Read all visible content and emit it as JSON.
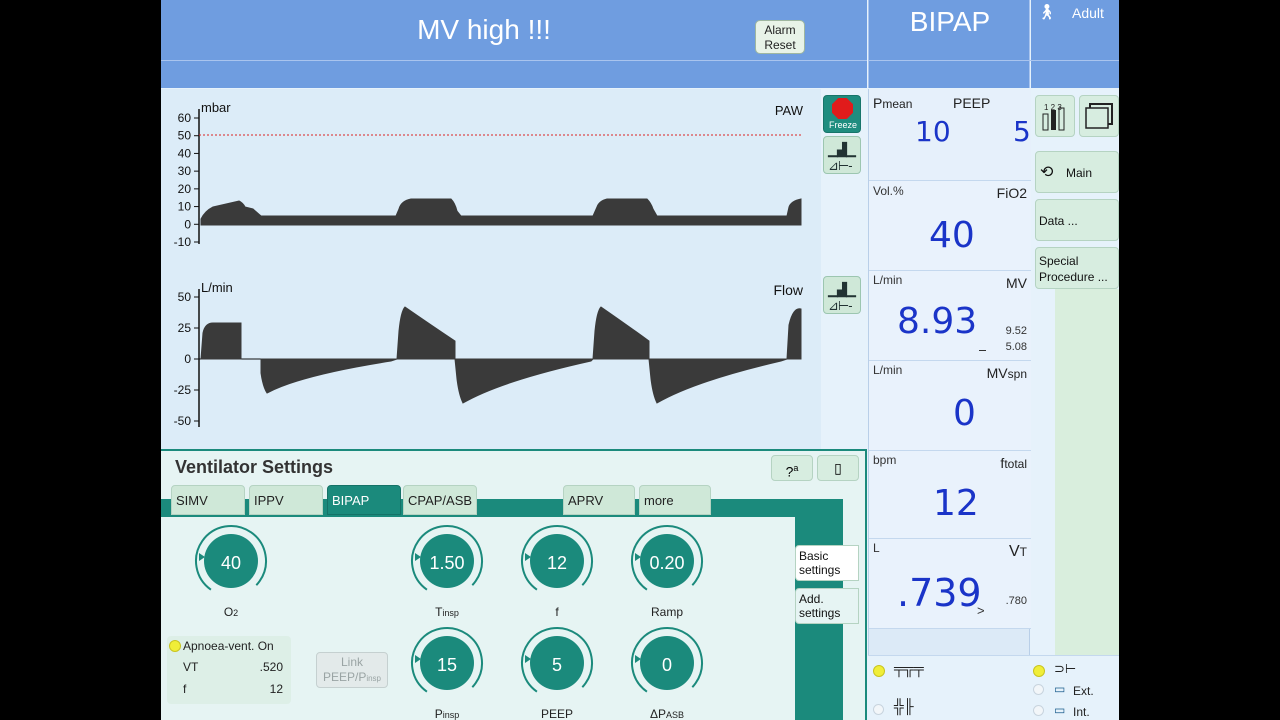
{
  "header": {
    "alarm_message": "MV high !!!",
    "alarm_reset_line1": "Alarm",
    "alarm_reset_line2": "Reset",
    "mode": "BIPAP",
    "patient_type": "Adult"
  },
  "waveforms": {
    "paw": {
      "unit": "mbar",
      "name": "PAW",
      "ticks": [
        "60",
        "50",
        "40",
        "30",
        "20",
        "10",
        "0",
        "-10"
      ],
      "alarm_limit": 50
    },
    "flow": {
      "unit": "L/min",
      "name": "Flow",
      "ticks": [
        "50",
        "25",
        "0",
        "-25",
        "-50"
      ]
    },
    "freeze_label": "Freeze"
  },
  "measured": {
    "pmean": {
      "label": "P",
      "sub": "mean",
      "value": "10"
    },
    "peep": {
      "label": "PEEP",
      "value": "5"
    },
    "fio2": {
      "unit": "Vol.%",
      "label": "FiO2",
      "value": "40"
    },
    "mv": {
      "unit": "L/min",
      "label": "MV",
      "value": "8.93",
      "upper": "9.52",
      "lower": "5.08"
    },
    "mvspn": {
      "unit": "L/min",
      "label": "MV",
      "sub": "spn",
      "value": "0"
    },
    "ftotal": {
      "unit": "bpm",
      "label": "f",
      "sub": "total",
      "value": "12"
    },
    "vt": {
      "unit": "L",
      "label": "V",
      "sub": "T",
      "value": ".739",
      "marker": ">",
      "limit": ".780"
    }
  },
  "menu": {
    "main": "Main",
    "data": "Data ...",
    "special_line1": "Special",
    "special_line2": "Procedure ..."
  },
  "status": {
    "ext": "Ext.",
    "int": "Int."
  },
  "settings": {
    "title": "Ventilator Settings",
    "help_label": "?",
    "tabs": [
      "SIMV",
      "IPPV",
      "BIPAP",
      "CPAP/ASB",
      "APRV",
      "more"
    ],
    "active_tab": "BIPAP",
    "side_basic_1": "Basic",
    "side_basic_2": "settings",
    "side_add_1": "Add.",
    "side_add_2": "settings",
    "knobs": {
      "o2": {
        "value": "40",
        "label": "O",
        "sub": "2"
      },
      "tinsp": {
        "value": "1.50",
        "label": "T",
        "sub": "insp"
      },
      "f": {
        "value": "12",
        "label": "f"
      },
      "ramp": {
        "value": "0.20",
        "label": "Ramp"
      },
      "pinsp": {
        "value": "15",
        "label": "P",
        "sub": "insp"
      },
      "peep": {
        "value": "5",
        "label": "PEEP"
      },
      "dpasb": {
        "value": "0",
        "label": "ΔP",
        "sub": "ASB"
      }
    },
    "apnoea": {
      "title": "Apnoea-vent. On",
      "vt_label": "VT",
      "vt_value": ".520",
      "f_label": "f",
      "f_value": "12"
    },
    "link_line1": "Link",
    "link_line2": "PEEP/P",
    "link_sub": "insp"
  },
  "colors": {
    "header_blue": "#6f9de0",
    "value_blue": "#1a34c8",
    "teal": "#1b8a7c",
    "led_yellow": "#f0ee38",
    "alarm_limit_red": "#d22"
  }
}
